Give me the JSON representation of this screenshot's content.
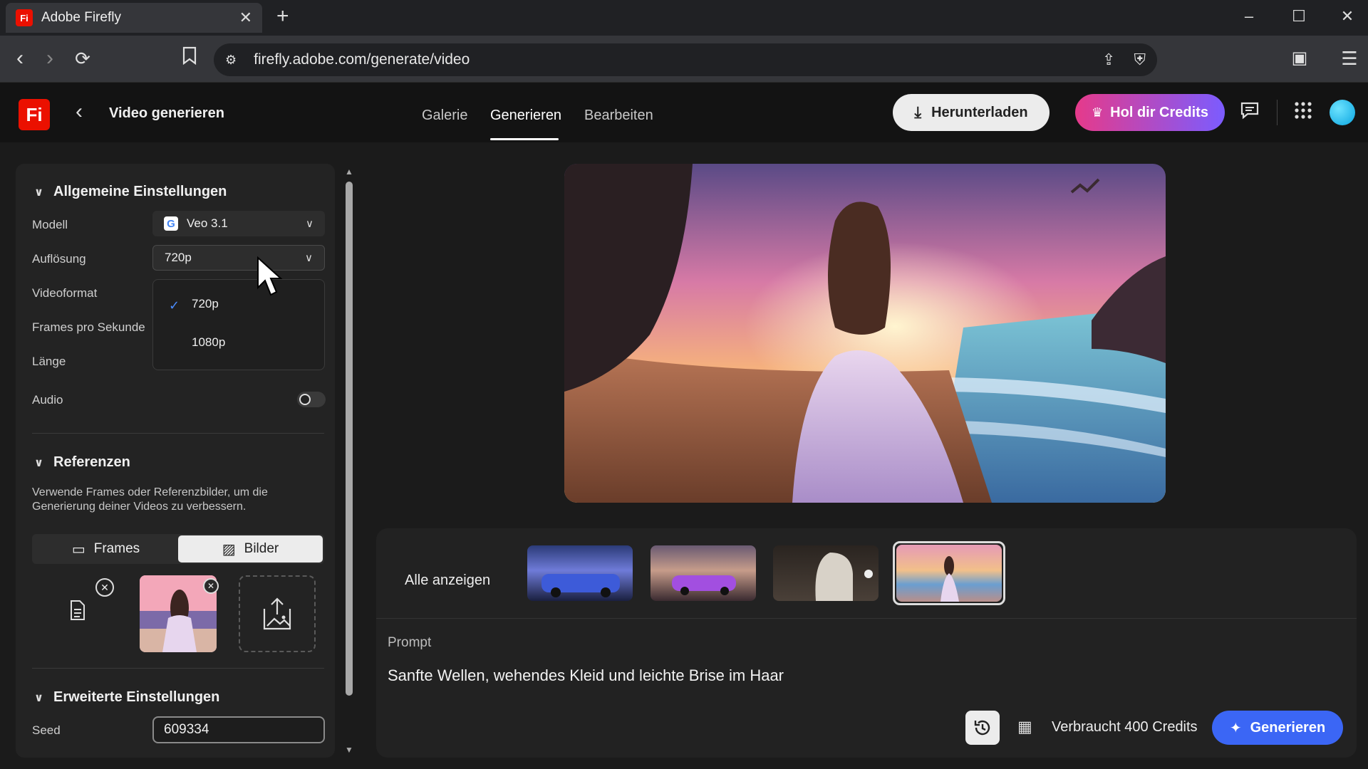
{
  "browser": {
    "tab_title": "Adobe Firefly",
    "favicon_text": "Fi",
    "url": "firefly.adobe.com/generate/video",
    "window_controls": [
      "–",
      "☐",
      "✕"
    ]
  },
  "header": {
    "logo_text": "Fi",
    "page_title": "Video generieren",
    "tabs": [
      {
        "label": "Galerie"
      },
      {
        "label": "Generieren",
        "active": true
      },
      {
        "label": "Bearbeiten"
      }
    ],
    "download_label": "Herunterladen",
    "credits_label": "Hol dir Credits"
  },
  "general_settings": {
    "title": "Allgemeine Einstellungen",
    "model_label": "Modell",
    "model_value": "Veo 3.1",
    "model_icon_letter": "G",
    "resolution_label": "Auflösung",
    "resolution_value": "720p",
    "resolution_options": [
      "720p",
      "1080p"
    ],
    "videoformat_label": "Videoformat",
    "fps_label": "Frames pro Sekunde",
    "length_label": "Länge",
    "audio_label": "Audio"
  },
  "references": {
    "title": "Referenzen",
    "description": "Verwende Frames oder Referenzbilder, um die Generierung deiner Videos zu verbessern.",
    "frames_label": "Frames",
    "images_label": "Bilder"
  },
  "advanced": {
    "title": "Erweiterte Einstellungen",
    "seed_label": "Seed",
    "seed_value": "609334"
  },
  "gallery": {
    "show_all_label": "Alle anzeigen"
  },
  "prompt": {
    "label": "Prompt",
    "text": "Sanfte Wellen, wehendes Kleid und leichte Brise im Haar"
  },
  "footer": {
    "credits_text": "Verbraucht 400 Credits",
    "generate_label": "Generieren"
  },
  "colors": {
    "accent_blue": "#3b66f5",
    "adobe_red": "#eb1000"
  }
}
